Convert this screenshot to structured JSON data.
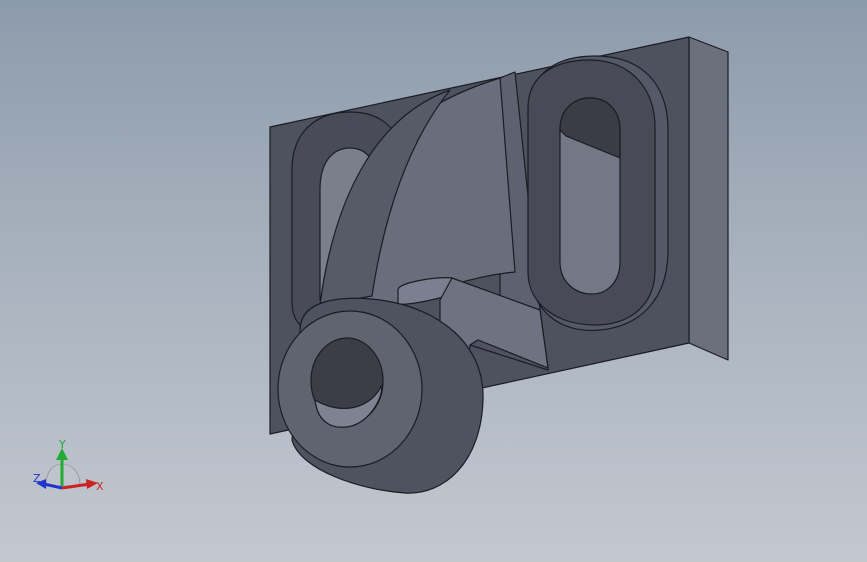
{
  "viewport": {
    "background_top": "#8c9bac",
    "background_bottom": "#c3c8cf"
  },
  "model": {
    "part_color": "#5b5f6c",
    "edge_color": "#1a1c22"
  },
  "triad": {
    "x_label": "X",
    "y_label": "Y",
    "z_label": "Z",
    "x_color": "#cc2222",
    "y_color": "#22aa33",
    "z_color": "#2233cc"
  }
}
